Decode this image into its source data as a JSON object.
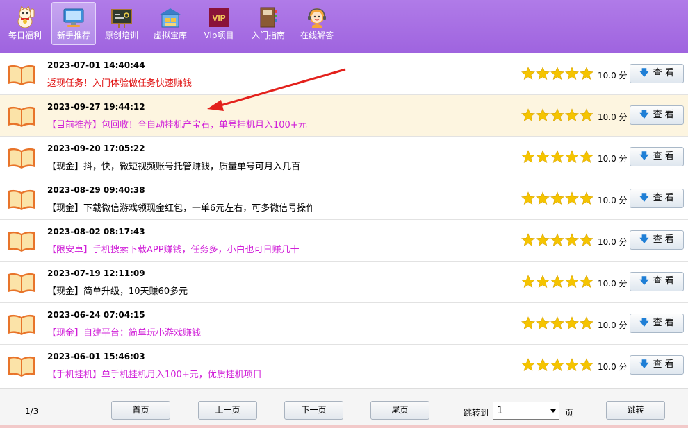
{
  "toolbar": {
    "items": [
      {
        "label": "每日福利",
        "icon": "lucky-cat-icon"
      },
      {
        "label": "新手推荐",
        "icon": "monitor-icon"
      },
      {
        "label": "原创培训",
        "icon": "blackboard-icon"
      },
      {
        "label": "虚拟宝库",
        "icon": "warehouse-icon"
      },
      {
        "label": "Vip项目",
        "icon": "vip-icon"
      },
      {
        "label": "入门指南",
        "icon": "guide-book-icon"
      },
      {
        "label": "在线解答",
        "icon": "support-agent-icon"
      }
    ],
    "vip_badge_text": "VIP",
    "active_index": 1
  },
  "list": {
    "rows": [
      {
        "date": "2023-07-01 14:40:44",
        "title": "返现任务！入门体验做任务快速赚钱",
        "title_color": "#e01010",
        "score": "10.0 分",
        "button": "查 看"
      },
      {
        "date": "2023-09-27 19:44:12",
        "title": "【目前推荐】包回收！全自动挂机产宝石，单号挂机月入100+元",
        "title_color": "#d020d8",
        "score": "10.0 分",
        "button": "查 看"
      },
      {
        "date": "2023-09-20 17:05:22",
        "title": "【现金】抖，快，微短视频账号托管赚钱，质量单号可月入几百",
        "title_color": "#000000",
        "score": "10.0 分",
        "button": "查 看"
      },
      {
        "date": "2023-08-29 09:40:38",
        "title": "【现金】下载微信游戏领现金红包，一单6元左右，可多微信号操作",
        "title_color": "#000000",
        "score": "10.0 分",
        "button": "查 看"
      },
      {
        "date": "2023-08-02 08:17:43",
        "title": "【限安卓】手机搜索下载APP赚钱，任务多，小白也可日赚几十",
        "title_color": "#d020d8",
        "score": "10.0 分",
        "button": "查 看"
      },
      {
        "date": "2023-07-19 12:11:09",
        "title": "【现金】简单升级，10天赚60多元",
        "title_color": "#000000",
        "score": "10.0 分",
        "button": "查 看"
      },
      {
        "date": "2023-06-24 07:04:15",
        "title": "【现金】自建平台：简单玩小游戏赚钱",
        "title_color": "#d020d8",
        "score": "10.0 分",
        "button": "查 看"
      },
      {
        "date": "2023-06-01 15:46:03",
        "title": "【手机挂机】单手机挂机月入100+元，优质挂机项目",
        "title_color": "#d020d8",
        "score": "10.0 分",
        "button": "查 看"
      }
    ],
    "highlight_index": 1,
    "star_rating": 5,
    "star_max": 5
  },
  "footer": {
    "page_info": "1/3",
    "first": "首页",
    "prev": "上一页",
    "next": "下一页",
    "last": "尾页",
    "jump_label": "跳转到",
    "jump_value": "1",
    "page_unit": "页",
    "go": "跳转"
  },
  "colors": {
    "toolbar_bg": "#a56be2",
    "star": "#f5c400",
    "highlight_row": "#fdf5e0",
    "annotation_arrow": "#e3211c"
  }
}
